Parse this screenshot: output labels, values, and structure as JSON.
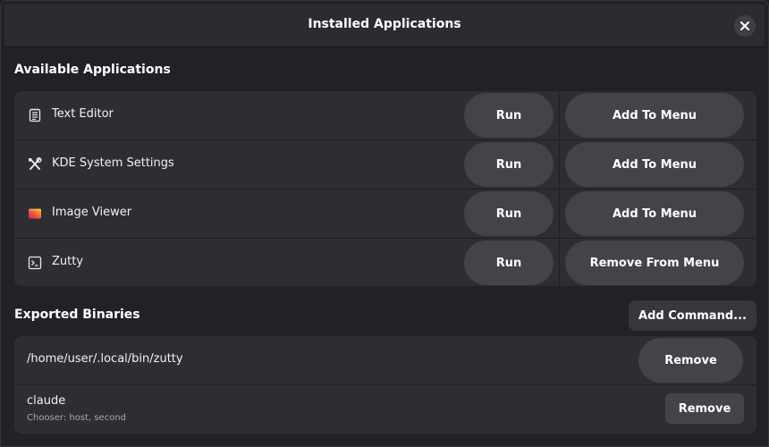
{
  "window": {
    "title": "Installed Applications"
  },
  "available_apps": {
    "heading": "Available Applications",
    "items": [
      {
        "name": "Text Editor",
        "icon": "text-editor-icon",
        "run_label": "Run",
        "menu_label": "Add To Menu"
      },
      {
        "name": "KDE System Settings",
        "icon": "settings-tools-icon",
        "run_label": "Run",
        "menu_label": "Add To Menu"
      },
      {
        "name": "Image Viewer",
        "icon": "image-viewer-icon",
        "run_label": "Run",
        "menu_label": "Add To Menu"
      },
      {
        "name": "Zutty",
        "icon": "terminal-icon",
        "run_label": "Run",
        "menu_label": "Remove From Menu"
      }
    ]
  },
  "exported_binaries": {
    "heading": "Exported Binaries",
    "add_command_label": "Add Command...",
    "items": [
      {
        "path": "/home/user/.local/bin/zutty",
        "remove_label": "Remove"
      },
      {
        "name": "claude",
        "subtitle": "Chooser: host, second",
        "remove_label": "Remove"
      }
    ]
  },
  "colors": {
    "background": "#222226",
    "card": "#2e2e32",
    "button": "#434348",
    "text": "#ffffff",
    "subtext": "#a8a8ad"
  }
}
